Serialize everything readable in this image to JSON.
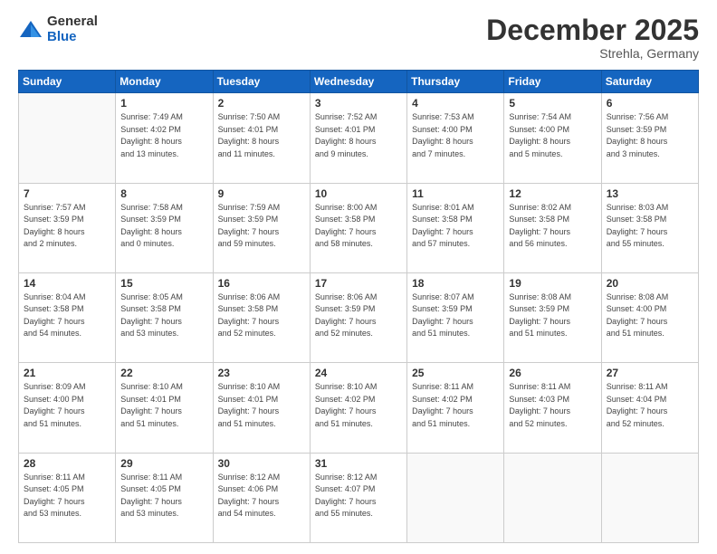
{
  "logo": {
    "general": "General",
    "blue": "Blue"
  },
  "header": {
    "month": "December 2025",
    "location": "Strehla, Germany"
  },
  "weekdays": [
    "Sunday",
    "Monday",
    "Tuesday",
    "Wednesday",
    "Thursday",
    "Friday",
    "Saturday"
  ],
  "weeks": [
    [
      {
        "day": "",
        "info": ""
      },
      {
        "day": "1",
        "info": "Sunrise: 7:49 AM\nSunset: 4:02 PM\nDaylight: 8 hours\nand 13 minutes."
      },
      {
        "day": "2",
        "info": "Sunrise: 7:50 AM\nSunset: 4:01 PM\nDaylight: 8 hours\nand 11 minutes."
      },
      {
        "day": "3",
        "info": "Sunrise: 7:52 AM\nSunset: 4:01 PM\nDaylight: 8 hours\nand 9 minutes."
      },
      {
        "day": "4",
        "info": "Sunrise: 7:53 AM\nSunset: 4:00 PM\nDaylight: 8 hours\nand 7 minutes."
      },
      {
        "day": "5",
        "info": "Sunrise: 7:54 AM\nSunset: 4:00 PM\nDaylight: 8 hours\nand 5 minutes."
      },
      {
        "day": "6",
        "info": "Sunrise: 7:56 AM\nSunset: 3:59 PM\nDaylight: 8 hours\nand 3 minutes."
      }
    ],
    [
      {
        "day": "7",
        "info": "Sunrise: 7:57 AM\nSunset: 3:59 PM\nDaylight: 8 hours\nand 2 minutes."
      },
      {
        "day": "8",
        "info": "Sunrise: 7:58 AM\nSunset: 3:59 PM\nDaylight: 8 hours\nand 0 minutes."
      },
      {
        "day": "9",
        "info": "Sunrise: 7:59 AM\nSunset: 3:59 PM\nDaylight: 7 hours\nand 59 minutes."
      },
      {
        "day": "10",
        "info": "Sunrise: 8:00 AM\nSunset: 3:58 PM\nDaylight: 7 hours\nand 58 minutes."
      },
      {
        "day": "11",
        "info": "Sunrise: 8:01 AM\nSunset: 3:58 PM\nDaylight: 7 hours\nand 57 minutes."
      },
      {
        "day": "12",
        "info": "Sunrise: 8:02 AM\nSunset: 3:58 PM\nDaylight: 7 hours\nand 56 minutes."
      },
      {
        "day": "13",
        "info": "Sunrise: 8:03 AM\nSunset: 3:58 PM\nDaylight: 7 hours\nand 55 minutes."
      }
    ],
    [
      {
        "day": "14",
        "info": "Sunrise: 8:04 AM\nSunset: 3:58 PM\nDaylight: 7 hours\nand 54 minutes."
      },
      {
        "day": "15",
        "info": "Sunrise: 8:05 AM\nSunset: 3:58 PM\nDaylight: 7 hours\nand 53 minutes."
      },
      {
        "day": "16",
        "info": "Sunrise: 8:06 AM\nSunset: 3:58 PM\nDaylight: 7 hours\nand 52 minutes."
      },
      {
        "day": "17",
        "info": "Sunrise: 8:06 AM\nSunset: 3:59 PM\nDaylight: 7 hours\nand 52 minutes."
      },
      {
        "day": "18",
        "info": "Sunrise: 8:07 AM\nSunset: 3:59 PM\nDaylight: 7 hours\nand 51 minutes."
      },
      {
        "day": "19",
        "info": "Sunrise: 8:08 AM\nSunset: 3:59 PM\nDaylight: 7 hours\nand 51 minutes."
      },
      {
        "day": "20",
        "info": "Sunrise: 8:08 AM\nSunset: 4:00 PM\nDaylight: 7 hours\nand 51 minutes."
      }
    ],
    [
      {
        "day": "21",
        "info": "Sunrise: 8:09 AM\nSunset: 4:00 PM\nDaylight: 7 hours\nand 51 minutes."
      },
      {
        "day": "22",
        "info": "Sunrise: 8:10 AM\nSunset: 4:01 PM\nDaylight: 7 hours\nand 51 minutes."
      },
      {
        "day": "23",
        "info": "Sunrise: 8:10 AM\nSunset: 4:01 PM\nDaylight: 7 hours\nand 51 minutes."
      },
      {
        "day": "24",
        "info": "Sunrise: 8:10 AM\nSunset: 4:02 PM\nDaylight: 7 hours\nand 51 minutes."
      },
      {
        "day": "25",
        "info": "Sunrise: 8:11 AM\nSunset: 4:02 PM\nDaylight: 7 hours\nand 51 minutes."
      },
      {
        "day": "26",
        "info": "Sunrise: 8:11 AM\nSunset: 4:03 PM\nDaylight: 7 hours\nand 52 minutes."
      },
      {
        "day": "27",
        "info": "Sunrise: 8:11 AM\nSunset: 4:04 PM\nDaylight: 7 hours\nand 52 minutes."
      }
    ],
    [
      {
        "day": "28",
        "info": "Sunrise: 8:11 AM\nSunset: 4:05 PM\nDaylight: 7 hours\nand 53 minutes."
      },
      {
        "day": "29",
        "info": "Sunrise: 8:11 AM\nSunset: 4:05 PM\nDaylight: 7 hours\nand 53 minutes."
      },
      {
        "day": "30",
        "info": "Sunrise: 8:12 AM\nSunset: 4:06 PM\nDaylight: 7 hours\nand 54 minutes."
      },
      {
        "day": "31",
        "info": "Sunrise: 8:12 AM\nSunset: 4:07 PM\nDaylight: 7 hours\nand 55 minutes."
      },
      {
        "day": "",
        "info": ""
      },
      {
        "day": "",
        "info": ""
      },
      {
        "day": "",
        "info": ""
      }
    ]
  ]
}
